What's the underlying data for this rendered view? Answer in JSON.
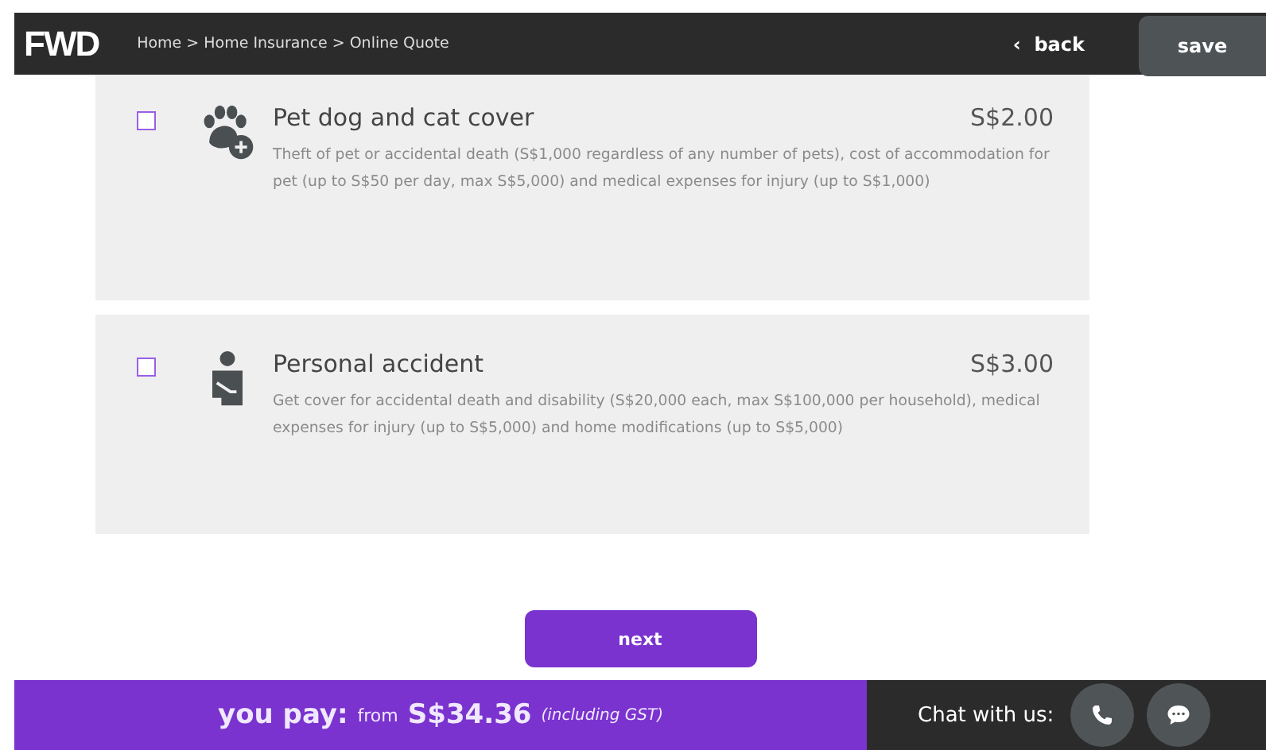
{
  "header": {
    "logo": "FWD",
    "breadcrumb": "Home > Home Insurance > Online Quote",
    "back": {
      "arrow": "‹",
      "label": "back"
    },
    "save": "save"
  },
  "options": [
    {
      "kind": "pet",
      "title": "Pet dog and cat cover",
      "price": "S$2.00",
      "checked": false,
      "description": "Theft of pet or accidental death (S$1,000 regardless of any number of pets), cost of accommodation for pet (up to S$50 per day, max S$5,000) and medical expenses for injury (up to S$1,000)"
    },
    {
      "kind": "accident",
      "title": "Personal accident",
      "price": "S$3.00",
      "checked": false,
      "description": "Get cover for accidental death and disability (S$20,000 each, max S$100,000 per household), medical expenses for injury (up to S$5,000) and home modifications (up to S$5,000)"
    }
  ],
  "next_button": "next",
  "footer": {
    "pay_label": "you pay:",
    "from": "from",
    "amount": "S$34.36",
    "note": "(including GST)",
    "chat_label": "Chat with us:"
  }
}
